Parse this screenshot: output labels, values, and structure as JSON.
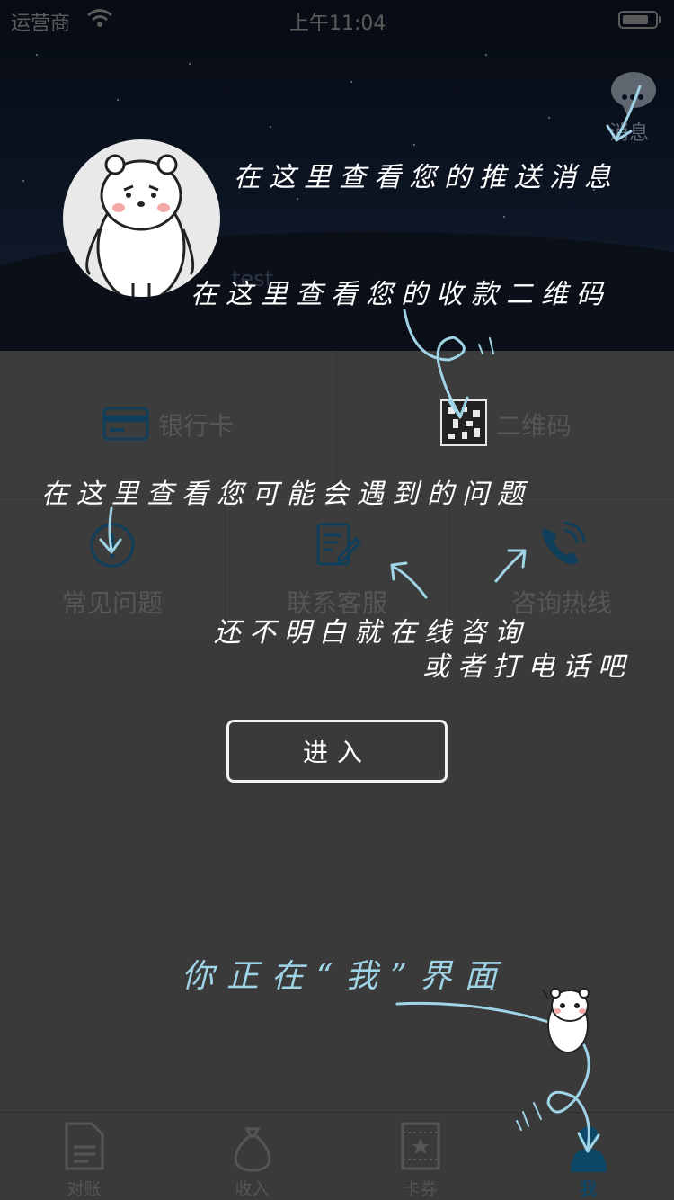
{
  "status_bar": {
    "carrier": "运营商",
    "time": "上午11:04"
  },
  "header": {
    "message_label": "消息",
    "username": "test"
  },
  "quick_links": [
    {
      "label": "银行卡",
      "icon": "bank-card-icon"
    },
    {
      "label": "二维码",
      "icon": "qr-code-icon"
    }
  ],
  "services": [
    {
      "label": "常见问题",
      "icon": "question-icon"
    },
    {
      "label": "联系客服",
      "icon": "edit-note-icon"
    },
    {
      "label": "咨询热线",
      "icon": "phone-icon"
    }
  ],
  "tabbar": [
    {
      "label": "对账",
      "icon": "document-icon",
      "active": false
    },
    {
      "label": "收入",
      "icon": "money-bag-icon",
      "active": false
    },
    {
      "label": "卡券",
      "icon": "coupon-icon",
      "active": false
    },
    {
      "label": "我",
      "icon": "user-icon",
      "active": true
    }
  ],
  "guide": {
    "tip_messages": "在这里查看您的推送消息",
    "tip_qrcode": "在这里查看您的收款二维码",
    "tip_faq": "在这里查看您可能会遇到的问题",
    "tip_contact_line1": "还不明白就在线咨询",
    "tip_contact_line2": "或者打电话吧",
    "enter_button": "进入",
    "tip_current": "你正在“我”界面"
  },
  "colors": {
    "accent": "#0e4868",
    "guide_blue": "#9fd3e6",
    "overlay_text": "#ffffff"
  }
}
